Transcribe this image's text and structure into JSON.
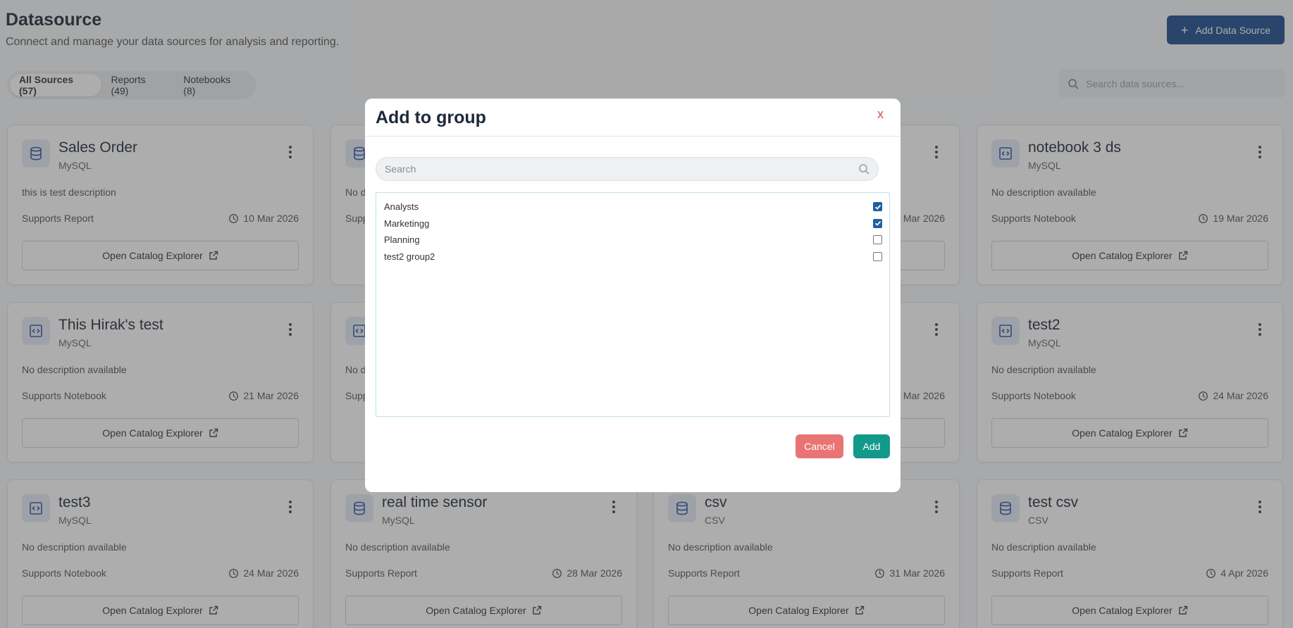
{
  "header": {
    "title": "Datasource",
    "subtitle": "Connect and manage your data sources for analysis and reporting.",
    "add_button_label": "Add Data Source"
  },
  "tabs": [
    {
      "label": "All Sources (57)",
      "active": true
    },
    {
      "label": "Reports (49)",
      "active": false
    },
    {
      "label": "Notebooks (8)",
      "active": false
    }
  ],
  "search": {
    "placeholder": "Search data sources..."
  },
  "cards": [
    {
      "title": "Sales Order",
      "type": "MySQL",
      "icon": "database-icon",
      "description": "this is test description",
      "support": "Supports Report",
      "date": "10 Mar 2026",
      "button": "Open Catalog Explorer"
    },
    {
      "title": "notebook 3 ds",
      "type": "MySQL",
      "icon": "code-icon",
      "description": "No description available",
      "support": "Supports Notebook",
      "date": "19 Mar 2026",
      "button": "Open Catalog Explorer"
    },
    {
      "title": "This Hirak's test",
      "type": "MySQL",
      "icon": "code-icon",
      "description": "No description available",
      "support": "Supports Notebook",
      "date": "21 Mar 2026",
      "button": "Open Catalog Explorer"
    },
    {
      "title": "test2",
      "type": "MySQL",
      "icon": "code-icon",
      "description": "No description available",
      "support": "Supports Notebook",
      "date": "24 Mar 2026",
      "button": "Open Catalog Explorer"
    },
    {
      "title": "test3",
      "type": "MySQL",
      "icon": "code-icon",
      "description": "No description available",
      "support": "Supports Notebook",
      "date": "24 Mar 2026",
      "button": "Open Catalog Explorer"
    },
    {
      "title": "real time sensor",
      "type": "MySQL",
      "icon": "database-icon",
      "description": "No description available",
      "support": "Supports Report",
      "date": "28 Mar 2026",
      "button": "Open Catalog Explorer"
    },
    {
      "title": "csv",
      "type": "CSV",
      "icon": "database-icon",
      "description": "No description available",
      "support": "Supports Report",
      "date": "31 Mar 2026",
      "button": "Open Catalog Explorer"
    },
    {
      "title": "test csv",
      "type": "CSV",
      "icon": "database-icon",
      "description": "No description available",
      "support": "Supports Report",
      "date": "4 Apr 2026",
      "button": "Open Catalog Explorer"
    }
  ],
  "partial_cards": [
    {
      "icon": "database-icon",
      "description_fragment": "No d",
      "support_fragment": "Supp",
      "date_fragment": "Mar 2026"
    },
    {
      "icon": "code-icon",
      "description_fragment": "No d",
      "support_fragment": "Supp",
      "date_fragment": "Mar 2026"
    }
  ],
  "modal": {
    "title": "Add to group",
    "close_label": "x",
    "search_placeholder": "Search",
    "groups": [
      {
        "name": "Analysts",
        "checked": true
      },
      {
        "name": "Marketingg",
        "checked": true
      },
      {
        "name": "Planning",
        "checked": false
      },
      {
        "name": "test2 group2",
        "checked": false
      }
    ],
    "cancel_label": "Cancel",
    "add_label": "Add"
  },
  "colors": {
    "primary": "#1d4d8f",
    "cancel": "#e97474",
    "add": "#13998a",
    "checkbox": "#1d5fa3"
  }
}
